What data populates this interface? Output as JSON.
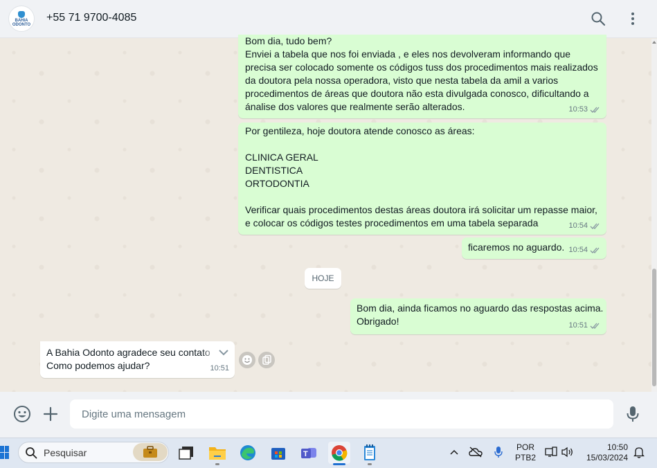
{
  "header": {
    "avatar_label": "BAHIA ODONTO",
    "contact_name": "+55 71 9700-4085"
  },
  "messages": [
    {
      "text": "Bom dia, tudo bem?\nEnviei a tabela que nos foi enviada , e eles nos devolveram informando que precisa ser colocado somente os códigos tuss dos procedimentos mais realizados da doutora pela nossa operadora, visto que nesta tabela da amil a varios procedimentos de áreas que doutora não esta divulgada conosco, dificultando a ánalise dos valores que realmente serão alterados.",
      "time": "10:53"
    },
    {
      "text": "Por gentileza, hoje doutora atende conosco as áreas:\n\nCLINICA GERAL\nDENTISTICA\nORTODONTIA\n\nVerificar quais procedimentos destas áreas doutora irá solicitar um repasse maior, e colocar os códigos testes procedimentos em uma tabela separada",
      "time": "10:54"
    },
    {
      "text": "ficaremos no aguardo.",
      "time": "10:54"
    },
    {
      "text": "Bom dia, ainda ficamos no aguardo das respostas acima.\nObrigado!",
      "time": "10:51"
    },
    {
      "text": "A Bahia Odonto agradece seu contato\nComo podemos ajudar?",
      "time": "10:51"
    }
  ],
  "date_divider": "HOJE",
  "composer": {
    "placeholder": "Digite uma mensagem"
  },
  "taskbar": {
    "search_label": "Pesquisar",
    "language_line1": "POR",
    "language_line2": "PTB2",
    "time": "10:50",
    "date": "15/03/2024"
  },
  "colors": {
    "outgoing_bubble": "#d9fdd3",
    "incoming_bubble": "#ffffff",
    "chat_background": "#efeae2",
    "header_background": "#f0f2f5",
    "read_ticks": "#8696a0"
  },
  "icons": {
    "header": [
      "search-icon",
      "menu-dots-icon"
    ],
    "composer": [
      "emoji-icon",
      "plus-icon",
      "mic-icon"
    ],
    "taskbar_apps": [
      "start-icon",
      "work-widget-icon",
      "app-window-icon",
      "file-explorer-icon",
      "edge-icon",
      "store-icon",
      "teams-icon",
      "chrome-icon",
      "notepad-icon"
    ],
    "tray": [
      "chevron-up-icon",
      "onedrive-icon",
      "mic-icon",
      "network-icon",
      "volume-icon",
      "notification-bell-icon"
    ]
  }
}
